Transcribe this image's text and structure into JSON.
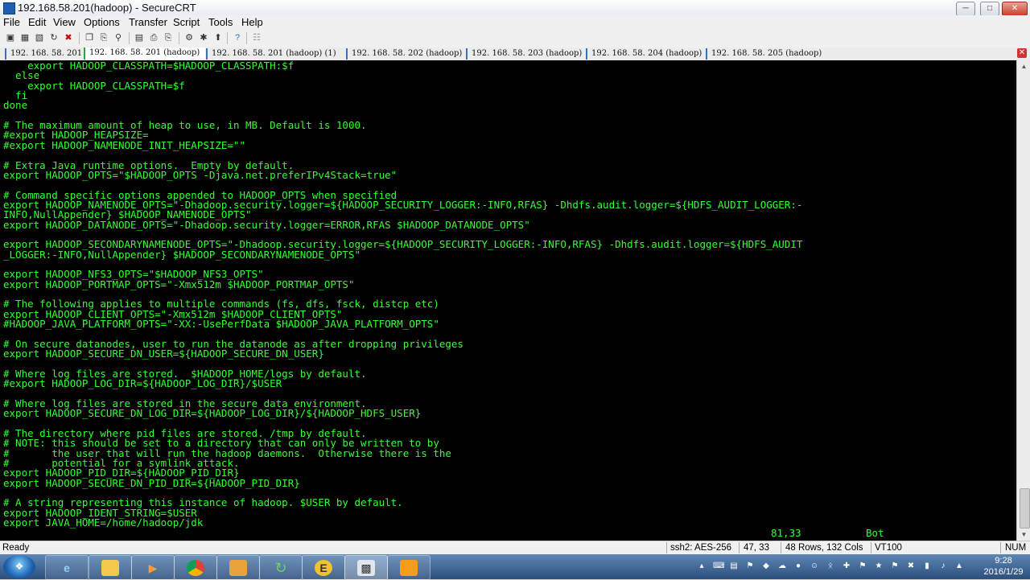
{
  "window": {
    "title": "192.168.58.201(hadoop) - SecureCRT",
    "min_label": "─",
    "max_label": "□",
    "close_label": "✕"
  },
  "menu": [
    "File",
    "Edit",
    "View",
    "Options",
    "Transfer",
    "Script",
    "Tools",
    "Help"
  ],
  "toolbar_icons": [
    "connect-icon",
    "quick-connect-icon",
    "connect-tab-icon",
    "reconnect-icon",
    "disconnect-icon",
    "copy-icon",
    "paste-icon",
    "find-icon",
    "print-setup-icon",
    "print-icon",
    "print-selection-icon",
    "session-options-icon",
    "global-options-icon",
    "sftp-icon",
    "help-icon",
    "keymap-icon"
  ],
  "tabs": [
    "192. 168. 58. 201",
    "192. 168. 58. 201 (hadoop)",
    "192. 168. 58. 201 (hadoop)   (1)",
    "192. 168. 58. 202 (hadoop)",
    "192. 168. 58. 203 (hadoop)",
    "192. 168. 58. 204 (hadoop)",
    "192. 168. 58. 205 (hadoop)"
  ],
  "active_tab_index": 1,
  "terminal": {
    "lines": [
      "    export HADOOP_CLASSPATH=$HADOOP_CLASSPATH:$f",
      "  else",
      "    export HADOOP_CLASSPATH=$f",
      "  fi",
      "done",
      "",
      "# The maximum amount of heap to use, in MB. Default is 1000.",
      "#export HADOOP_HEAPSIZE=",
      "#export HADOOP_NAMENODE_INIT_HEAPSIZE=\"\"",
      "",
      "# Extra Java runtime options.  Empty by default.",
      "export HADOOP_OPTS=\"$HADOOP_OPTS -Djava.net.preferIPv4Stack=true\"",
      "",
      "# Command specific options appended to HADOOP_OPTS when specified",
      "export HADOOP_NAMENODE_OPTS=\"-Dhadoop.security.logger=${HADOOP_SECURITY_LOGGER:-INFO,RFAS} -Dhdfs.audit.logger=${HDFS_AUDIT_LOGGER:-",
      "INFO,NullAppender} $HADOOP_NAMENODE_OPTS\"",
      "export HADOOP_DATANODE_OPTS=\"-Dhadoop.security.logger=ERROR,RFAS $HADOOP_DATANODE_OPTS\"",
      "",
      "export HADOOP_SECONDARYNAMENODE_OPTS=\"-Dhadoop.security.logger=${HADOOP_SECURITY_LOGGER:-INFO,RFAS} -Dhdfs.audit.logger=${HDFS_AUDIT",
      "_LOGGER:-INFO,NullAppender} $HADOOP_SECONDARYNAMENODE_OPTS\"",
      "",
      "export HADOOP_NFS3_OPTS=\"$HADOOP_NFS3_OPTS\"",
      "export HADOOP_PORTMAP_OPTS=\"-Xmx512m $HADOOP_PORTMAP_OPTS\"",
      "",
      "# The following applies to multiple commands (fs, dfs, fsck, distcp etc)",
      "export HADOOP_CLIENT_OPTS=\"-Xmx512m $HADOOP_CLIENT_OPTS\"",
      "#HADOOP_JAVA_PLATFORM_OPTS=\"-XX:-UsePerfData $HADOOP_JAVA_PLATFORM_OPTS\"",
      "",
      "# On secure datanodes, user to run the datanode as after dropping privileges",
      "export HADOOP_SECURE_DN_USER=${HADOOP_SECURE_DN_USER}",
      "",
      "# Where log files are stored.  $HADOOP_HOME/logs by default.",
      "#export HADOOP_LOG_DIR=${HADOOP_LOG_DIR}/$USER",
      "",
      "# Where log files are stored in the secure data environment.",
      "export HADOOP_SECURE_DN_LOG_DIR=${HADOOP_LOG_DIR}/${HADOOP_HDFS_USER}",
      "",
      "# The directory where pid files are stored. /tmp by default.",
      "# NOTE: this should be set to a directory that can only be written to by",
      "#       the user that will run the hadoop daemons.  Otherwise there is the",
      "#       potential for a symlink attack.",
      "export HADOOP_PID_DIR=${HADOOP_PID_DIR}",
      "export HADOOP_SECURE_DN_PID_DIR=${HADOOP_PID_DIR}",
      "",
      "# A string representing this instance of hadoop. $USER by default.",
      "export HADOOP_IDENT_STRING=$USER",
      "export JAVA_HOME=/home/hadoop/jdk"
    ],
    "cursor_position": "81,33",
    "scroll_position": "Bot"
  },
  "status_bar": {
    "state": "Ready",
    "encryption": "ssh2: AES-256",
    "cursor": "47,  33",
    "size": "48 Rows, 132 Cols",
    "emulation": "VT100",
    "num_lock": "NUM"
  },
  "taskbar": {
    "apps": [
      "internet-explorer-icon",
      "file-explorer-icon",
      "media-player-icon",
      "chrome-icon",
      "securecrt-icon",
      "refresh-app-icon",
      "app-e-icon",
      "terminal-app-icon",
      "virtualbox-icon"
    ],
    "active_app_index": 7,
    "clock_time": "9:28",
    "clock_date": "2016/1/29"
  }
}
